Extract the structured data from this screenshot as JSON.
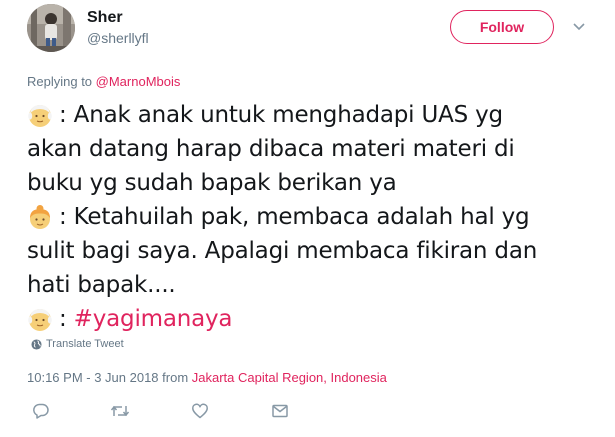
{
  "user": {
    "name": "Sher",
    "handle": "@sherllyfl"
  },
  "follow_button": {
    "label": "Follow"
  },
  "reply_context": {
    "prefix": "Replying to ",
    "mention": "@MarnoMbois"
  },
  "tweet": {
    "lines": [
      {
        "emoji": "older-man",
        "text": ": Anak anak untuk menghadapi UAS yg"
      },
      {
        "text": "akan datang harap dibaca materi materi di"
      },
      {
        "text": "buku yg sudah bapak berikan ya"
      },
      {
        "emoji": "person-with-bun",
        "text": ": Ketahuilah pak, membaca adalah hal yg"
      },
      {
        "text": "sulit bagi saya. Apalagi membaca fikiran dan"
      },
      {
        "text": "hati bapak...."
      },
      {
        "emoji": "older-man",
        "text": ": ",
        "hashtag": "#yagimanaya"
      }
    ]
  },
  "translate_label": "Translate Tweet",
  "timestamp": {
    "time_date": "10:16 PM - 3 Jun 2018",
    "from": " from ",
    "location": "Jakarta Capital Region, Indonesia"
  },
  "actions": [
    "reply-icon",
    "retweet-icon",
    "like-icon",
    "direct-message-icon"
  ],
  "colors": {
    "accent": "#e0245e",
    "secondary_text": "#657786",
    "primary_text": "#14171a"
  }
}
